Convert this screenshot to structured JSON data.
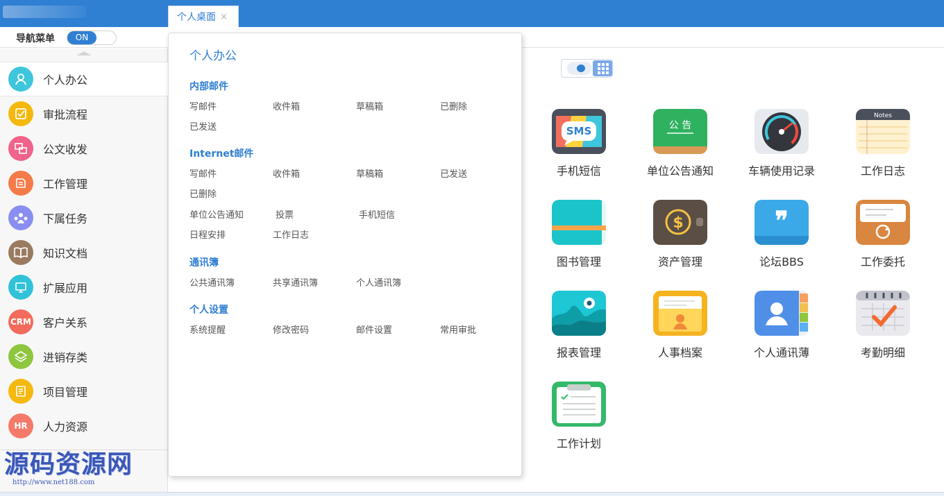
{
  "tab": {
    "label": "个人桌面",
    "close": "×"
  },
  "nav_toggle": {
    "label": "导航菜单",
    "state": "ON"
  },
  "sidebar": {
    "items": [
      {
        "label": "个人办公",
        "icon": "user-icon",
        "color": "#3ec6dc",
        "badge": ""
      },
      {
        "label": "审批流程",
        "icon": "approve-icon",
        "color": "#f5b80e",
        "badge": ""
      },
      {
        "label": "公文收发",
        "icon": "document-transfer-icon",
        "color": "#f0638a",
        "badge": ""
      },
      {
        "label": "工作管理",
        "icon": "work-icon",
        "color": "#f57a4a",
        "badge": ""
      },
      {
        "label": "下属任务",
        "icon": "team-icon",
        "color": "#8a8ef0",
        "badge": ""
      },
      {
        "label": "知识文档",
        "icon": "book-icon",
        "color": "#9a7b60",
        "badge": ""
      },
      {
        "label": "扩展应用",
        "icon": "extension-icon",
        "color": "#30c2d8",
        "badge": ""
      },
      {
        "label": "客户关系",
        "icon": "crm-icon",
        "color": "#f26b5c",
        "badge": "CRM"
      },
      {
        "label": "进销存类",
        "icon": "inventory-icon",
        "color": "#8ec63f",
        "badge": ""
      },
      {
        "label": "项目管理",
        "icon": "project-icon",
        "color": "#f5b80e",
        "badge": ""
      },
      {
        "label": "人力资源",
        "icon": "hr-icon",
        "color": "#f57a6a",
        "badge": "HR"
      }
    ]
  },
  "menu": {
    "title": "个人办公",
    "sections": [
      {
        "title": "内部邮件",
        "items": [
          "写邮件",
          "收件箱",
          "草稿箱",
          "已删除",
          "已发送"
        ]
      },
      {
        "title": "Internet邮件",
        "items": [
          "写邮件",
          "收件箱",
          "草稿箱",
          "已发送",
          "已删除"
        ]
      },
      {
        "title": "",
        "items": [
          "单位公告通知",
          "投票",
          "手机短信",
          "日程安排",
          "工作日志"
        ]
      },
      {
        "title": "通讯簿",
        "items": [
          "公共通讯簿",
          "共享通讯簿",
          "个人通讯簿"
        ]
      },
      {
        "title": "个人设置",
        "items": [
          "系统提醒",
          "修改密码",
          "邮件设置",
          "常用审批"
        ]
      }
    ]
  },
  "apps": [
    {
      "label": "手机短信",
      "icon": "sms-icon"
    },
    {
      "label": "单位公告通知",
      "icon": "notice-board-icon"
    },
    {
      "label": "车辆使用记录",
      "icon": "speedometer-icon"
    },
    {
      "label": "工作日志",
      "icon": "notes-icon"
    },
    {
      "label": "图书管理",
      "icon": "book-icon"
    },
    {
      "label": "资产管理",
      "icon": "wallet-icon"
    },
    {
      "label": "论坛BBS",
      "icon": "quote-bubble-icon"
    },
    {
      "label": "工作委托",
      "icon": "delegate-icon"
    },
    {
      "label": "报表管理",
      "icon": "report-icon"
    },
    {
      "label": "人事档案",
      "icon": "personnel-file-icon"
    },
    {
      "label": "个人通讯薄",
      "icon": "contacts-icon"
    },
    {
      "label": "考勤明细",
      "icon": "attendance-icon"
    },
    {
      "label": "工作计划",
      "icon": "clipboard-icon"
    }
  ],
  "icon_text": {
    "sms": "SMS",
    "notice": "公 告",
    "notes": "Notes",
    "dollar": "$",
    "quote": "❞"
  },
  "watermark": {
    "title": "源码资源网",
    "url": "http://www.net188.com"
  }
}
